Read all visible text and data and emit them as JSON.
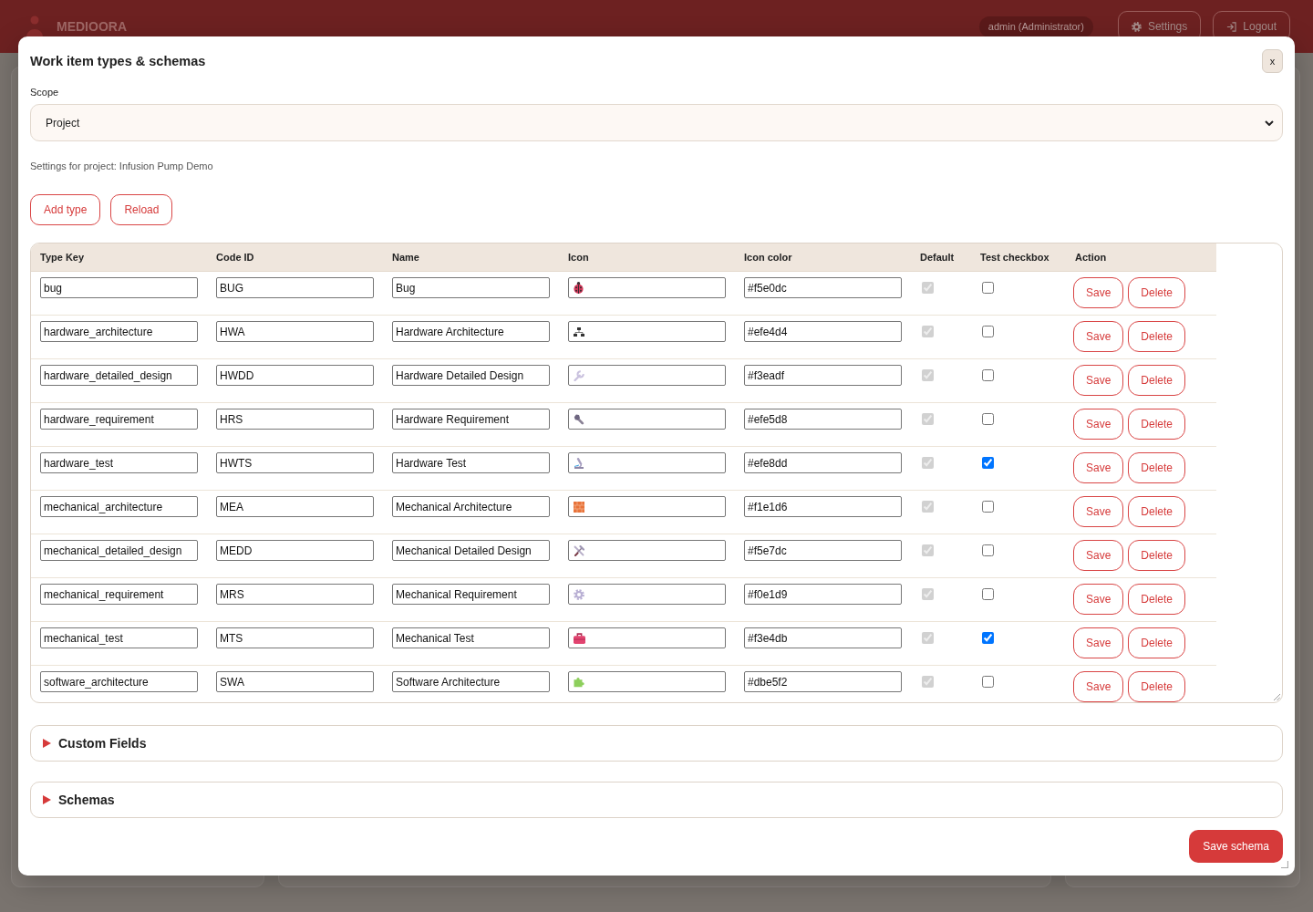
{
  "top_bar": {
    "brand": "MEDIOORA",
    "user": "admin (Administrator)",
    "buttons": [
      {
        "label": "Settings"
      },
      {
        "label": "Logout"
      }
    ]
  },
  "dialog": {
    "title": "Work item types & schemas",
    "close_label": "x",
    "scope": {
      "label": "Scope",
      "value": "Project"
    },
    "context": "Settings for project: Infusion Pump Demo",
    "buttons": [
      "Add type",
      "Reload"
    ],
    "table": {
      "columns": [
        "Type Key",
        "Code ID",
        "Name",
        "Icon",
        "Icon color",
        "Default",
        "Test checkbox",
        "Action"
      ],
      "rows": [
        {
          "type_key": "bug",
          "code_id": "BUG",
          "name": "Bug",
          "icon_color": "#f5e0dc",
          "default": {
            "checked": true,
            "disabled": true
          },
          "test_checkbox": {
            "checked": false
          },
          "actions": [
            "Save",
            "Delete"
          ]
        },
        {
          "type_key": "hardware_architecture",
          "code_id": "HWA",
          "name": "Hardware Architecture",
          "icon_color": "#efe4d4",
          "default": {
            "checked": true,
            "disabled": true
          },
          "test_checkbox": {
            "checked": false
          },
          "actions": [
            "Save",
            "Delete"
          ]
        },
        {
          "type_key": "hardware_detailed_design",
          "code_id": "HWDD",
          "name": "Hardware Detailed Design",
          "icon_color": "#f3eadf",
          "default": {
            "checked": true,
            "disabled": true
          },
          "test_checkbox": {
            "checked": false
          },
          "actions": [
            "Save",
            "Delete"
          ]
        },
        {
          "type_key": "hardware_requirement",
          "code_id": "HRS",
          "name": "Hardware Requirement",
          "icon_color": "#efe5d8",
          "default": {
            "checked": true,
            "disabled": true
          },
          "test_checkbox": {
            "checked": false
          },
          "actions": [
            "Save",
            "Delete"
          ]
        },
        {
          "type_key": "hardware_test",
          "code_id": "HWTS",
          "name": "Hardware Test",
          "icon_color": "#efe8dd",
          "default": {
            "checked": true,
            "disabled": true
          },
          "test_checkbox": {
            "checked": true
          },
          "actions": [
            "Save",
            "Delete"
          ]
        },
        {
          "type_key": "mechanical_architecture",
          "code_id": "MEA",
          "name": "Mechanical Architecture",
          "icon_color": "#f1e1d6",
          "default": {
            "checked": true,
            "disabled": true
          },
          "test_checkbox": {
            "checked": false
          },
          "actions": [
            "Save",
            "Delete"
          ]
        },
        {
          "type_key": "mechanical_detailed_design",
          "code_id": "MEDD",
          "name": "Mechanical Detailed Design",
          "icon_color": "#f5e7dc",
          "default": {
            "checked": true,
            "disabled": true
          },
          "test_checkbox": {
            "checked": false
          },
          "actions": [
            "Save",
            "Delete"
          ]
        },
        {
          "type_key": "mechanical_requirement",
          "code_id": "MRS",
          "name": "Mechanical Requirement",
          "icon_color": "#f0e1d9",
          "default": {
            "checked": true,
            "disabled": true
          },
          "test_checkbox": {
            "checked": false
          },
          "actions": [
            "Save",
            "Delete"
          ]
        },
        {
          "type_key": "mechanical_test",
          "code_id": "MTS",
          "name": "Mechanical Test",
          "icon_color": "#f3e4db",
          "default": {
            "checked": true,
            "disabled": true
          },
          "test_checkbox": {
            "checked": true
          },
          "actions": [
            "Save",
            "Delete"
          ]
        },
        {
          "type_key": "software_architecture",
          "code_id": "SWA",
          "name": "Software Architecture",
          "icon_color": "#dbe5f2",
          "default": {
            "checked": true,
            "disabled": true
          },
          "test_checkbox": {
            "checked": false
          },
          "actions": [
            "Save",
            "Delete"
          ]
        }
      ]
    },
    "sections": [
      {
        "title": "Custom Fields",
        "expanded": false
      },
      {
        "title": "Schemas",
        "expanded": false
      }
    ],
    "footer_button": "Save schema"
  }
}
